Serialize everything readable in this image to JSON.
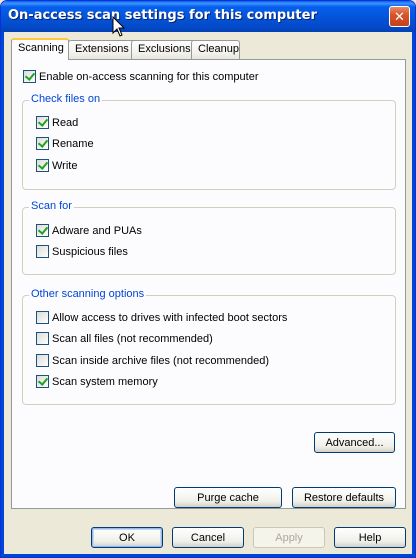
{
  "window": {
    "title": "On-access scan settings for this computer",
    "close_glyph": "✕"
  },
  "tabs": [
    "Scanning",
    "Extensions",
    "Exclusions",
    "Cleanup"
  ],
  "enable_label": "Enable on-access scanning for this computer",
  "check_files": {
    "title": "Check files on",
    "items": [
      {
        "label": "Read",
        "checked": true
      },
      {
        "label": "Rename",
        "checked": true
      },
      {
        "label": "Write",
        "checked": true
      }
    ]
  },
  "scan_for": {
    "title": "Scan for",
    "items": [
      {
        "label": "Adware and PUAs",
        "checked": true
      },
      {
        "label": "Suspicious files",
        "checked": false
      }
    ]
  },
  "other_options": {
    "title": "Other scanning options",
    "items": [
      {
        "label": "Allow access to drives with infected boot sectors",
        "checked": false
      },
      {
        "label": "Scan all files (not recommended)",
        "checked": false
      },
      {
        "label": "Scan inside archive files (not recommended)",
        "checked": false
      },
      {
        "label": "Scan system memory",
        "checked": true
      }
    ]
  },
  "buttons": {
    "advanced": "Advanced...",
    "purge": "Purge cache",
    "restore": "Restore defaults",
    "ok": "OK",
    "cancel": "Cancel",
    "apply": "Apply",
    "help": "Help"
  },
  "colors": {
    "title_bar": "#0453D8",
    "group_label": "#0046D5",
    "check_mark": "#21A121",
    "dialog_bg": "#ECE9D8"
  }
}
